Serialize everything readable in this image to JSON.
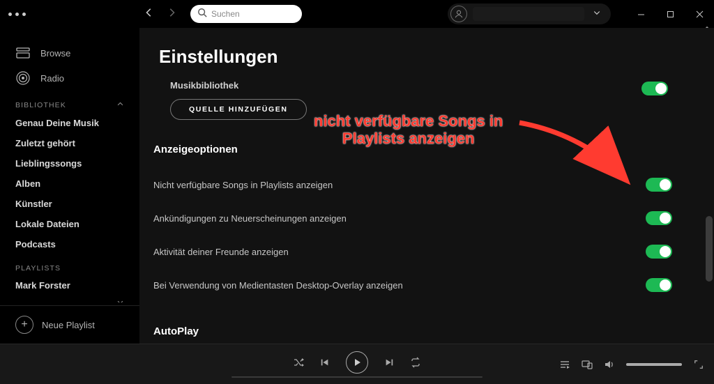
{
  "search": {
    "placeholder": "Suchen"
  },
  "sidebar": {
    "browse": "Browse",
    "radio": "Radio",
    "section_library": "BIBLIOTHEK",
    "items": [
      "Genau Deine Musik",
      "Zuletzt gehört",
      "Lieblingssongs",
      "Alben",
      "Künstler",
      "Lokale Dateien",
      "Podcasts"
    ],
    "section_playlists": "PLAYLISTS",
    "playlists": [
      "Mark Forster"
    ],
    "new_playlist": "Neue Playlist"
  },
  "settings": {
    "title": "Einstellungen",
    "library_label_cut": "Musikbibliothek",
    "add_source_btn": "QUELLE HINZUFÜGEN",
    "display_section": "Anzeigeoptionen",
    "rows": [
      {
        "label": "Nicht verfügbare Songs in Playlists anzeigen",
        "on": true
      },
      {
        "label": "Ankündigungen zu Neuerscheinungen anzeigen",
        "on": true
      },
      {
        "label": "Aktivität deiner Freunde anzeigen",
        "on": true
      },
      {
        "label": "Bei Verwendung von Medientasten Desktop-Overlay anzeigen",
        "on": true
      }
    ],
    "autoplay_section": "AutoPlay"
  },
  "annotation": {
    "line1": "nicht verfügbare Songs in",
    "line2": "Playlists anzeigen"
  }
}
